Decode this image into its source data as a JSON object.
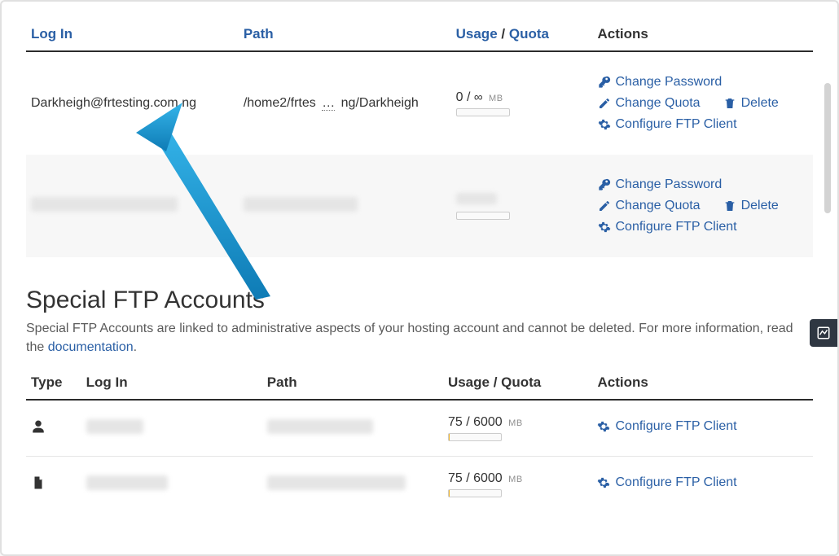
{
  "table1": {
    "headers": {
      "login": "Log In",
      "path": "Path",
      "usage": "Usage",
      "quota": "Quota",
      "sep": "/",
      "actions": "Actions"
    },
    "rows": [
      {
        "login": "Darkheigh@frtesting.com.ng",
        "path_left": "/home2/frtes",
        "path_mid": "…",
        "path_right": "ng/Darkheigh",
        "usage_used": "0",
        "usage_sep": "/",
        "usage_quota": "∞",
        "usage_unit": "MB",
        "actions": {
          "change_password": "Change Password",
          "change_quota": "Change Quota",
          "delete": "Delete",
          "configure": "Configure FTP Client"
        }
      },
      {
        "login": "██████████████",
        "path_left": "███████████",
        "usage_used": "██",
        "usage_unit": "MB",
        "actions": {
          "change_password": "Change Password",
          "change_quota": "Change Quota",
          "delete": "Delete",
          "configure": "Configure FTP Client"
        }
      }
    ]
  },
  "section": {
    "title": "Special FTP Accounts",
    "desc_pre": "Special FTP Accounts are linked to administrative aspects of your hosting account and cannot be deleted. For more information, read the ",
    "desc_link": "documentation",
    "desc_post": "."
  },
  "table2": {
    "headers": {
      "type": "Type",
      "login": "Log In",
      "path": "Path",
      "usage": "Usage / Quota",
      "actions": "Actions"
    },
    "rows": [
      {
        "type_icon": "user",
        "usage_used": "75",
        "usage_sep": "/",
        "usage_quota": "6000",
        "usage_unit": "MB",
        "configure": "Configure FTP Client"
      },
      {
        "type_icon": "file",
        "usage_used": "75",
        "usage_sep": "/",
        "usage_quota": "6000",
        "usage_unit": "MB",
        "configure": "Configure FTP Client"
      }
    ]
  }
}
